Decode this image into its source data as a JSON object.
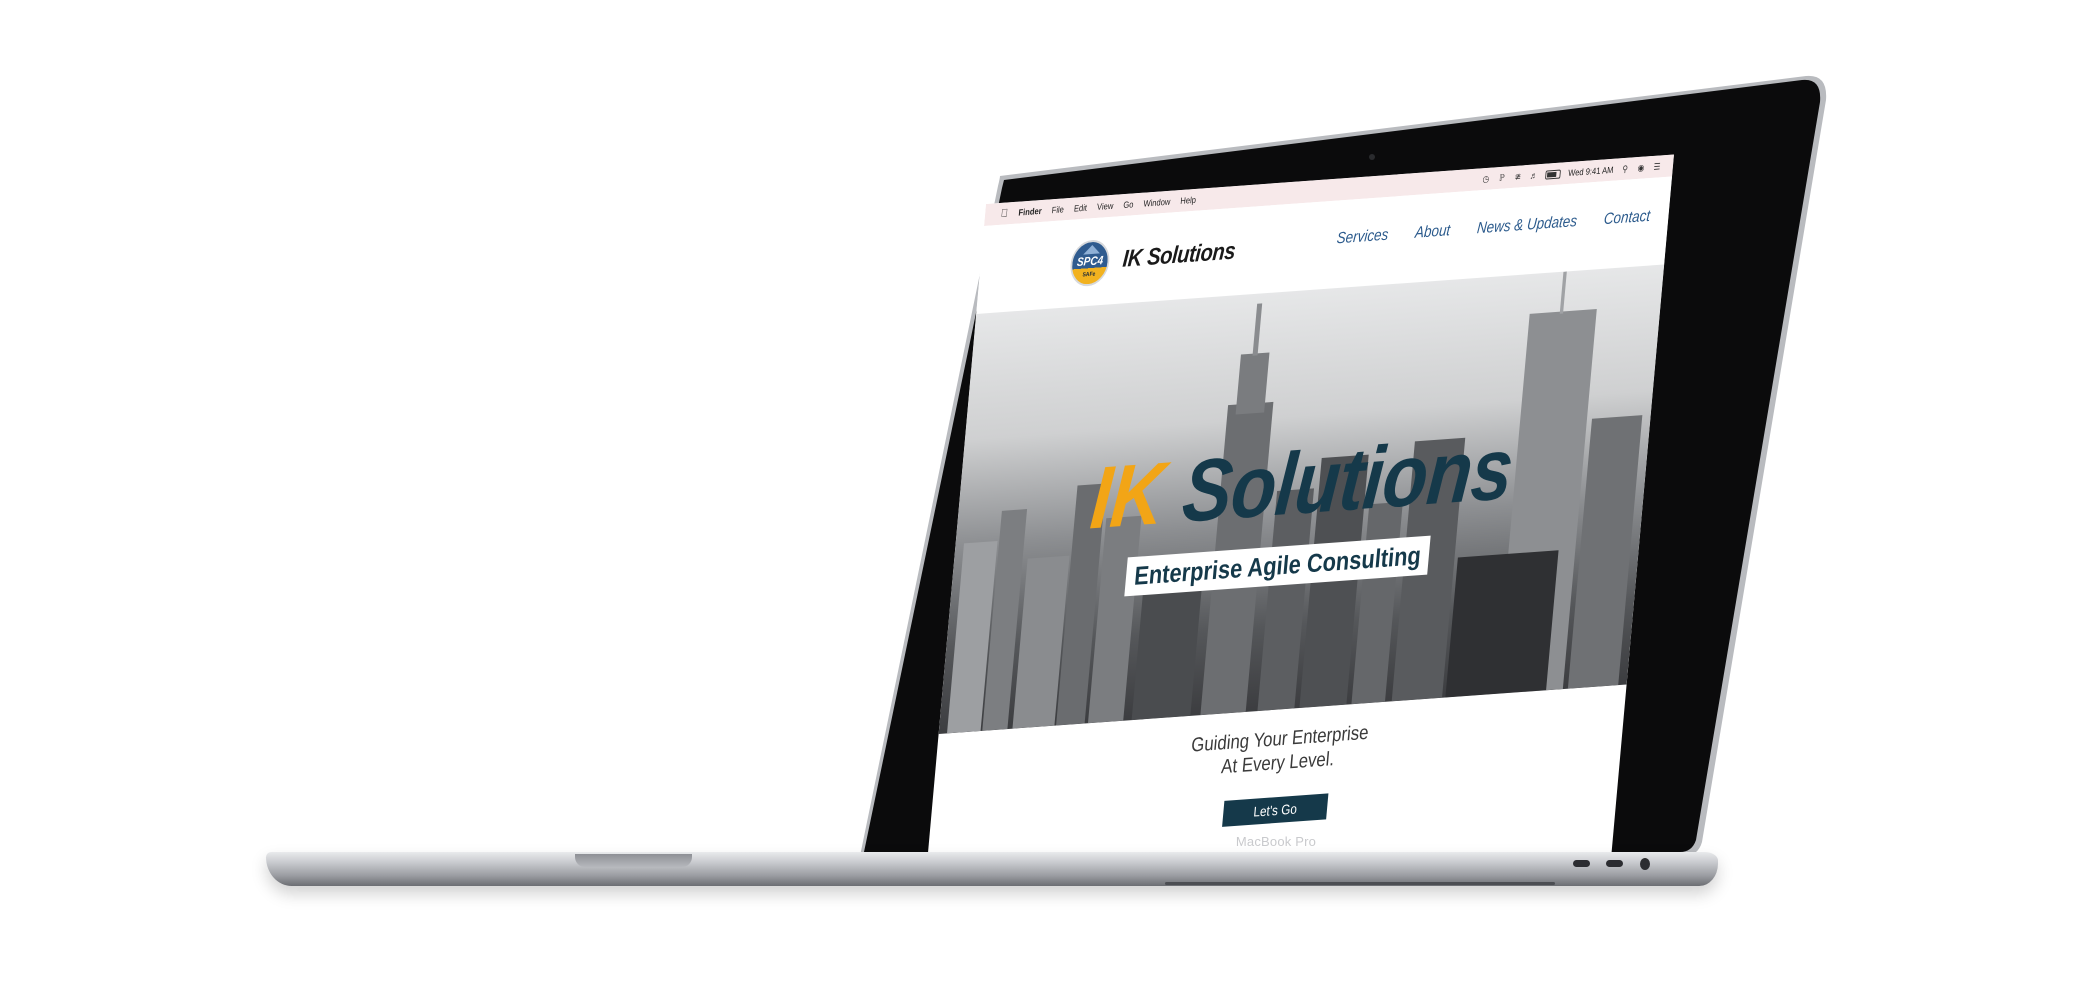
{
  "device": {
    "model_label": "MacBook Pro"
  },
  "menubar": {
    "apple_icon": "apple-icon",
    "items": [
      "Finder",
      "File",
      "Edit",
      "View",
      "Go",
      "Window",
      "Help"
    ],
    "clock": "Wed 9:41 AM",
    "status_icons": [
      "time-machine-icon",
      "bluetooth-icon",
      "wifi-icon",
      "volume-icon",
      "battery-icon",
      "search-icon",
      "siri-icon",
      "notification-center-icon"
    ]
  },
  "site": {
    "logo": {
      "badge_text": "SPC4",
      "badge_sub": "SAFe",
      "brand_name": "IK Solutions"
    },
    "nav": [
      "Services",
      "About",
      "News & Updates",
      "Contact"
    ],
    "hero": {
      "title_accent": "IK",
      "title_main": "Solutions",
      "tagline": "Enterprise Agile Consulting"
    },
    "subhead_line1": "Guiding Your Enterprise",
    "subhead_line2": "At Every Level.",
    "cta_label": "Let's Go"
  },
  "colors": {
    "brand_orange": "#f2a516",
    "brand_navy": "#15394a",
    "nav_blue": "#2b5a8c",
    "menubar_bg": "#f7e9ea"
  }
}
